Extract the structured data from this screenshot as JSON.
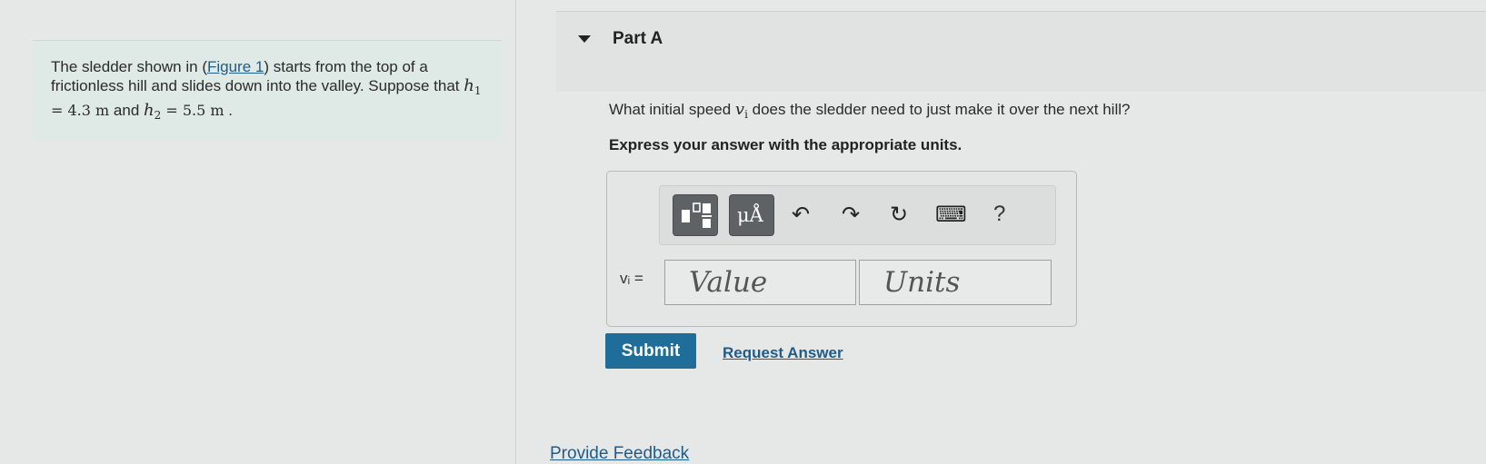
{
  "problem": {
    "text_before_link": "The sledder shown in (",
    "figure_link": "Figure 1",
    "text_after_link": ") starts from the top of a frictionless hill and slides down into the valley. Suppose that ",
    "h1_symbol": "h",
    "h1_sub": "1",
    "h1_value": " = 4.3  m",
    "and_text": " and ",
    "h2_symbol": "h",
    "h2_sub": "2",
    "h2_value": " = 5.5  m",
    "end": " ."
  },
  "part": {
    "title": "Part A",
    "question_before": "What initial speed ",
    "question_var": "v",
    "question_var_sub": "i",
    "question_after": " does the sledder need to just make it over the next hill?",
    "instruction": "Express your answer with the appropriate units."
  },
  "toolbar": {
    "templates_icon": "fraction-templates-icon",
    "units_icon_label": "μÅ",
    "undo_glyph": "↶",
    "redo_glyph": "↷",
    "reset_glyph": "↻",
    "keyboard_glyph": "⌨",
    "help_glyph": "?"
  },
  "answer": {
    "var_label": "vᵢ =",
    "value_placeholder": "Value",
    "units_placeholder": "Units"
  },
  "actions": {
    "submit": "Submit",
    "request_answer": "Request Answer",
    "feedback": "Provide Feedback"
  },
  "colors": {
    "accent": "#1f6e9a",
    "link": "#1e5c8a",
    "problem_bg": "#dfe9e6"
  }
}
